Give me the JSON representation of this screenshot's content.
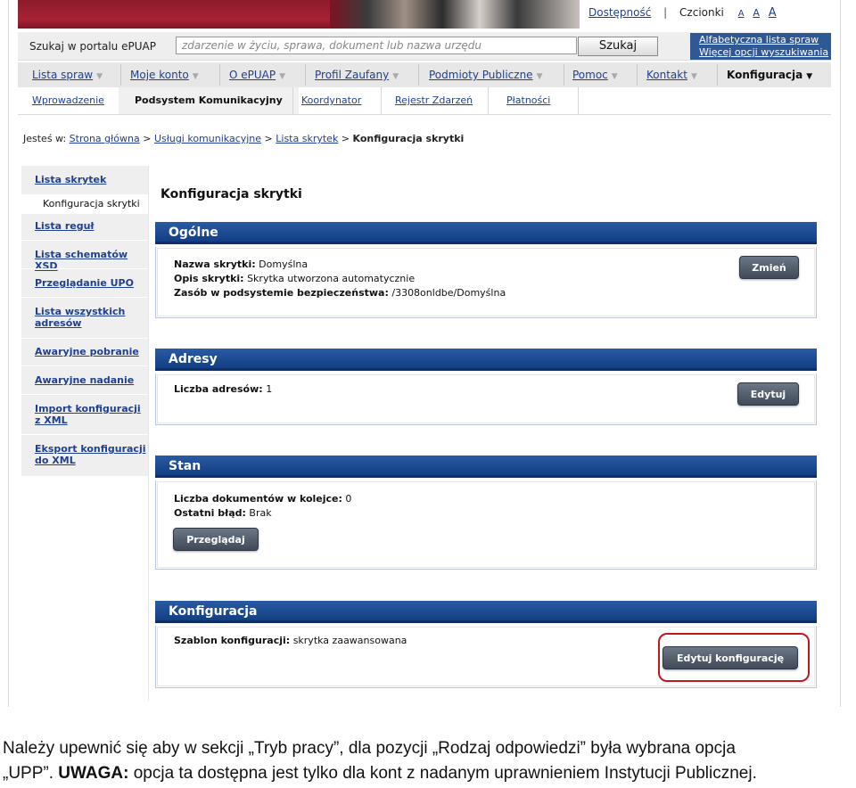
{
  "header": {
    "accessibility_link": "Dostępność",
    "font_label": "Czcionki",
    "font_sizes": [
      "A",
      "A",
      "A"
    ]
  },
  "search": {
    "label": "Szukaj w portalu ePUAP",
    "placeholder": "zdarzenie w życiu, sprawa, dokument lub nazwa urzędu",
    "button": "Szukaj",
    "alphabetical_link": "Alfabetyczna lista spraw",
    "more_options_link": "Więcej opcji wyszukiwania"
  },
  "main_menu": [
    {
      "label": "Lista spraw"
    },
    {
      "label": "Moje konto"
    },
    {
      "label": "O ePUAP"
    },
    {
      "label": "Profil Zaufany"
    },
    {
      "label": "Podmioty Publiczne"
    },
    {
      "label": "Pomoc"
    },
    {
      "label": "Kontakt"
    },
    {
      "label": "Konfiguracja",
      "active": true
    }
  ],
  "sub_menu": [
    {
      "label": "Wprowadzenie"
    },
    {
      "label": "Podsystem Komunikacyjny",
      "active": true
    },
    {
      "label": "Koordynator"
    },
    {
      "label": "Rejestr Zdarzeń"
    },
    {
      "label": "Płatności"
    }
  ],
  "breadcrumb": {
    "prefix": "Jesteś w:",
    "items": [
      "Strona główna",
      "Usługi komunikacyjne",
      "Lista skrytek"
    ],
    "separator": ">",
    "current": "Konfiguracja skrytki"
  },
  "left_nav": {
    "items": [
      {
        "label": "Lista skrytek"
      },
      {
        "label": "Konfiguracja skrytki",
        "sub": true
      },
      {
        "label": "Lista reguł"
      },
      {
        "label": "Lista schematów XSD"
      },
      {
        "label": "Przeglądanie UPO"
      },
      {
        "label": "Lista wszystkich adresów"
      },
      {
        "label": "Awaryjne pobranie"
      },
      {
        "label": "Awaryjne nadanie"
      },
      {
        "label": "Import konfiguracji z XML"
      },
      {
        "label": "Eksport konfiguracji do XML"
      }
    ]
  },
  "page": {
    "title": "Konfiguracja skrytki"
  },
  "panels": {
    "general": {
      "title": "Ogólne",
      "name_label": "Nazwa skrytki:",
      "name_value": "Domyślna",
      "desc_label": "Opis skrytki:",
      "desc_value": "Skrytka utworzona automatycznie",
      "resource_label": "Zasób w podsystemie bezpieczeństwa:",
      "resource_value": "/3308onldbe/Domyślna",
      "button": "Zmień"
    },
    "addresses": {
      "title": "Adresy",
      "count_label": "Liczba adresów:",
      "count_value": "1",
      "button": "Edytuj"
    },
    "status": {
      "title": "Stan",
      "queue_label": "Liczba dokumentów w kolejce:",
      "queue_value": "0",
      "error_label": "Ostatni błąd:",
      "error_value": "Brak",
      "button": "Przeglądaj"
    },
    "config": {
      "title": "Konfiguracja",
      "template_label": "Szablon konfiguracji:",
      "template_value": "skrytka zaawansowana",
      "button": "Edytuj konfigurację"
    }
  },
  "note": {
    "line1": "Należy upewnić się aby w sekcji „Tryb pracy”, dla pozycji „Rodzaj odpowiedzi” była wybrana opcja",
    "line2_start": "„UPP”. ",
    "warning_label": "UWAGA:",
    "line2_rest": " opcja ta dostępna jest tylko dla kont z nadanym uprawnieniem Instytucji Publicznej."
  },
  "colors": {
    "panel_header": "#1d4b92",
    "highlight": "#c0181f",
    "link": "#1f3f8f"
  }
}
